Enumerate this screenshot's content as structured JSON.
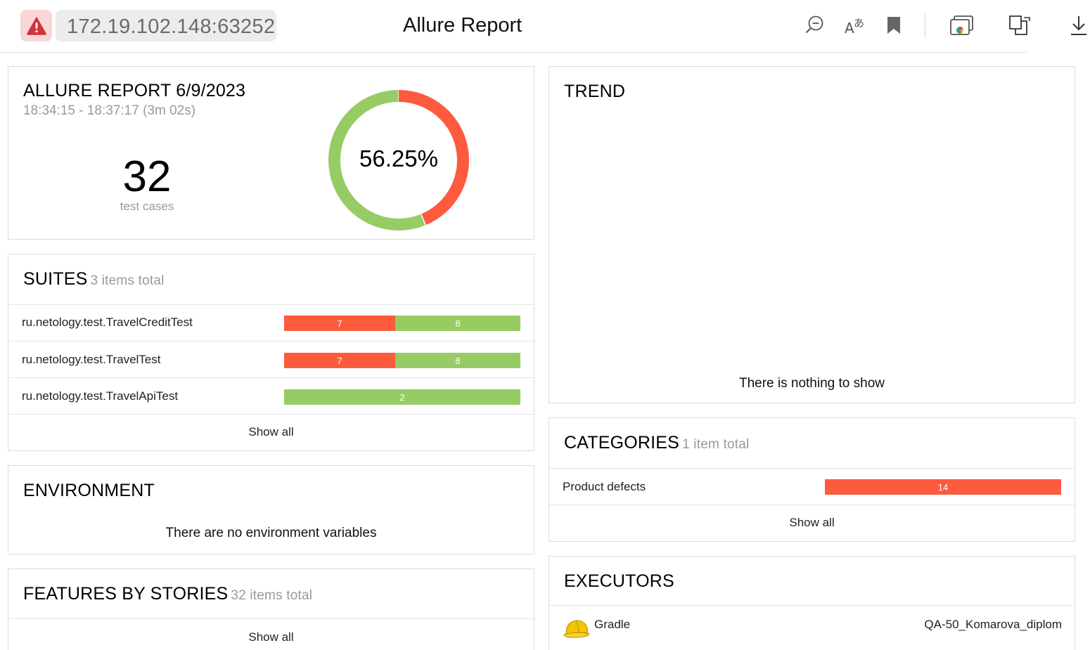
{
  "browser": {
    "url": "172.19.102.148:63252",
    "app_title": "Allure Report",
    "icons": [
      "warning-icon",
      "zoom-out-icon",
      "read-aloud-icon",
      "bookmark-icon",
      "browser-window-icon",
      "extensions-icon",
      "download-icon"
    ]
  },
  "summary": {
    "title": "ALLURE REPORT 6/9/2023",
    "time_range": "18:34:15 - 18:37:17 (3m 02s)",
    "test_count": "32",
    "test_count_label": "test cases",
    "percent_label": "56.25%",
    "passed_fraction": 0.5625,
    "colors": {
      "passed": "#97cc64",
      "failed": "#fd5a3e"
    }
  },
  "suites": {
    "title": "SUITES",
    "subtitle": "3 items total",
    "rows": [
      {
        "name": "ru.netology.test.TravelCreditTest",
        "failed": 7,
        "passed": 8,
        "failed_label": "7",
        "passed_label": "8"
      },
      {
        "name": "ru.netology.test.TravelTest",
        "failed": 7,
        "passed": 8,
        "failed_label": "7",
        "passed_label": "8"
      },
      {
        "name": "ru.netology.test.TravelApiTest",
        "failed": 0,
        "passed": 2,
        "failed_label": "",
        "passed_label": "2"
      }
    ],
    "show_all": "Show all"
  },
  "environment": {
    "title": "ENVIRONMENT",
    "message": "There are no environment variables"
  },
  "features": {
    "title": "FEATURES BY STORIES",
    "subtitle": "32 items total",
    "show_all": "Show all"
  },
  "trend": {
    "title": "TREND",
    "message": "There is nothing to show"
  },
  "categories": {
    "title": "CATEGORIES",
    "subtitle": "1 item total",
    "rows": [
      {
        "name": "Product defects",
        "count_label": "14"
      }
    ],
    "show_all": "Show all"
  },
  "executors": {
    "title": "EXECUTORS",
    "rows": [
      {
        "name": "Gradle",
        "build": "QA-50_Komarova_diplom",
        "icon": "hard-hat-icon"
      }
    ]
  }
}
